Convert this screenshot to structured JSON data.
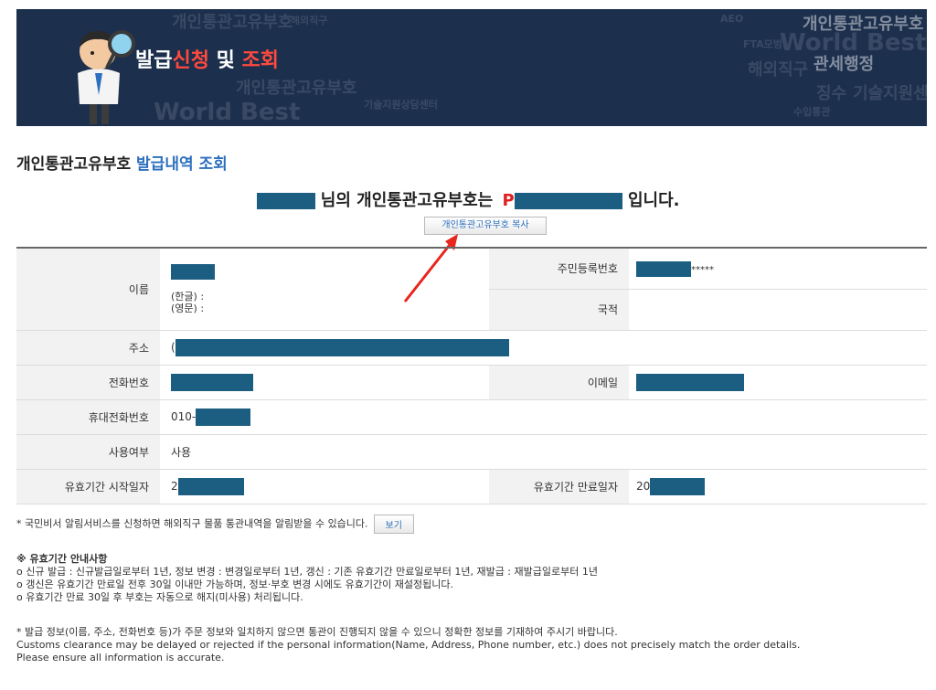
{
  "banner": {
    "title_part1": "발급",
    "title_part2": "신청",
    "title_part3": " 및 ",
    "title_part4": "조회",
    "bg_texts": [
      "개인통관고유부호",
      "World Best",
      "관세행정",
      "징수",
      "기술지원센터",
      "FTA모범",
      "해외직구",
      "수입통관",
      "기술지원상담센터",
      "AEO"
    ]
  },
  "section": {
    "title_part1": "개인통관고유부호 ",
    "title_part2": "발급내역 조회"
  },
  "headline": {
    "part1": " 님의 개인통관고유부호는 ",
    "prefix": "P",
    "part2": " 입니다."
  },
  "copy_button": "개인통관고유부호 복사",
  "table": {
    "name_label": "이름",
    "name_ko": "(한글) :",
    "name_en": "(영문) :",
    "rrn_label": "주민등록번호",
    "rrn_mask": "*****",
    "nationality_label": "국적",
    "address_label": "주소",
    "address_prefix": "(",
    "phone_label": "전화번호",
    "email_label": "이메일",
    "mobile_label": "휴대전화번호",
    "mobile_prefix": "010-",
    "usage_label": "사용여부",
    "usage_value": "사용",
    "start_label": "유효기간 시작일자",
    "start_prefix": "2",
    "end_label": "유효기간 만료일자",
    "end_prefix": "20"
  },
  "note1": "* 국민비서 알림서비스를 신청하면 해외직구 물품 통관내역을 알림받을 수 있습니다.",
  "view_button": "보기",
  "notice": {
    "head": "※ 유효기간 안내사항",
    "items": [
      "o 신규 발급 : 신규발급일로부터 1년, 정보 변경 : 변경일로부터 1년, 갱신 : 기존 유효기간 만료일로부터 1년, 재발급 : 재발급일로부터 1년",
      "o 갱신은 유효기간 만료일 전후 30일 이내만 가능하며, 정보·부호 변경 시에도 유효기간이 재설정됩니다.",
      "o 유효기간 만료 30일 후 부호는 자동으로 해지(미사용) 처리됩니다."
    ]
  },
  "disclaimer": {
    "ko": "* 발급 정보(이름, 주소, 전화번호 등)가 주문 정보와 일치하지 않으면 통관이 진행되지 않을 수 있으니 정확한 정보를 기재하여 주시기 바랍니다.",
    "en1": "Customs clearance may be delayed or rejected if the personal information(Name, Address, Phone number, etc.) does not precisely match the order details.",
    "en2": "Please ensure all information is accurate."
  },
  "colors": {
    "banner_bg": "#1c2f4d",
    "accent_red": "#ff4a3d",
    "accent_blue": "#2c6fbf",
    "redaction": "#1b5e82"
  }
}
